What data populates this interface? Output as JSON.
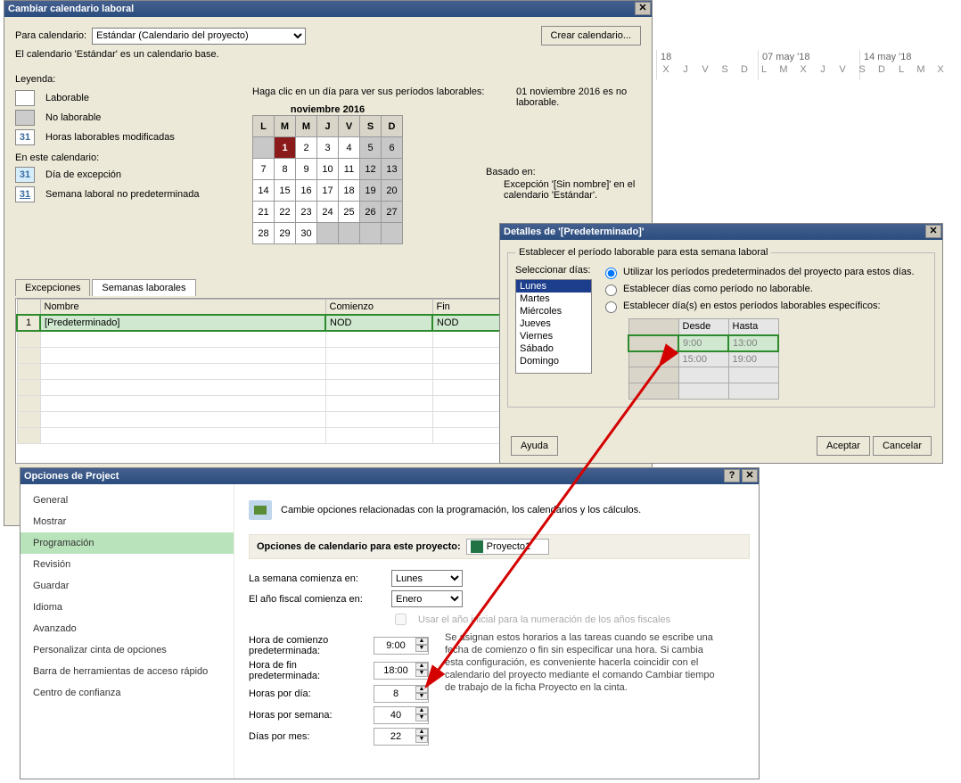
{
  "dlg1": {
    "title": "Cambiar calendario laboral",
    "forCalLabel": "Para calendario:",
    "forCal": "Estándar (Calendario del proyecto)",
    "createBtn": "Crear calendario...",
    "baseNote": "El calendario 'Estándar' es un calendario base.",
    "legendTitle": "Leyenda:",
    "legend": {
      "work": "Laborable",
      "nowork": "No laborable",
      "modified": "Horas laborables modificadas",
      "inCal": "En este calendario:",
      "exception": "Día de excepción",
      "nonDefWeek": "Semana laboral no predeterminada"
    },
    "hintClick": "Haga clic en un día para ver sus períodos laborables:",
    "hintDate": "01 noviembre 2016 es no laborable.",
    "basedOn": "Basado en:",
    "basedOnText": "Excepción '[Sin nombre]' en el calendario 'Estándar'.",
    "calTitle": "noviembre 2016",
    "weekDays": [
      "L",
      "M",
      "M",
      "J",
      "V",
      "S",
      "D"
    ],
    "tabs": [
      "Excepciones",
      "Semanas laborales"
    ],
    "gridHead": [
      "Nombre",
      "Comienzo",
      "Fin"
    ],
    "gridRow": [
      "[Predeterminado]",
      "NOD",
      "NOD"
    ]
  },
  "dlg2": {
    "title": "Detalles de '[Predeterminado]'",
    "fieldset": "Establecer el período laborable para esta semana laboral",
    "selectDays": "Seleccionar días:",
    "radios": [
      "Utilizar los períodos predeterminados del proyecto para estos días.",
      "Establecer días como período no laborable.",
      "Establecer día(s) en estos períodos laborables específicos:"
    ],
    "days": [
      "Lunes",
      "Martes",
      "Miércoles",
      "Jueves",
      "Viernes",
      "Sábado",
      "Domingo"
    ],
    "timeHead": [
      "Desde",
      "Hasta"
    ],
    "times": [
      [
        "9:00",
        "13:00"
      ],
      [
        "15:00",
        "19:00"
      ]
    ],
    "help": "Ayuda",
    "ok": "Aceptar",
    "cancel": "Cancelar"
  },
  "dlg3": {
    "title": "Opciones de Project",
    "nav": [
      "General",
      "Mostrar",
      "Programación",
      "Revisión",
      "Guardar",
      "Idioma",
      "Avanzado",
      "Personalizar cinta de opciones",
      "Barra de herramientas de acceso rápido",
      "Centro de confianza"
    ],
    "heading": "Cambie opciones relacionadas con la programación, los calendarios y los cálculos.",
    "sectionLabel": "Opciones de calendario para este proyecto:",
    "project": "Proyecto1",
    "weekStartLbl": "La semana comienza en:",
    "weekStart": "Lunes",
    "fiscalLbl": "El año fiscal comienza en:",
    "fiscal": "Enero",
    "fiscalChk": "Usar el año inicial para la numeración de los años fiscales",
    "startHourLbl": "Hora de comienzo predeterminada:",
    "startHour": "9:00",
    "endHourLbl": "Hora de fin predeterminada:",
    "endHour": "18:00",
    "hDayLbl": "Horas por día:",
    "hDay": "8",
    "hWeekLbl": "Horas por semana:",
    "hWeek": "40",
    "dMonthLbl": "Días por mes:",
    "dMonth": "22",
    "note": "Se asignan estos horarios a las tareas cuando se escribe una fecha de comienzo o fin sin especificar una hora. Si cambia esta configuración, es conveniente hacerla coincidir con el calendario del proyecto mediante el comando Cambiar tiempo de trabajo de la ficha Proyecto en la cinta."
  },
  "gantt": {
    "months": [
      "18",
      "07 may '18",
      "14 may '18"
    ],
    "days": [
      "X",
      "J",
      "V",
      "S",
      "D",
      "L",
      "M",
      "X",
      "J",
      "V",
      "S",
      "D",
      "L",
      "M",
      "X"
    ]
  },
  "num31": "31"
}
